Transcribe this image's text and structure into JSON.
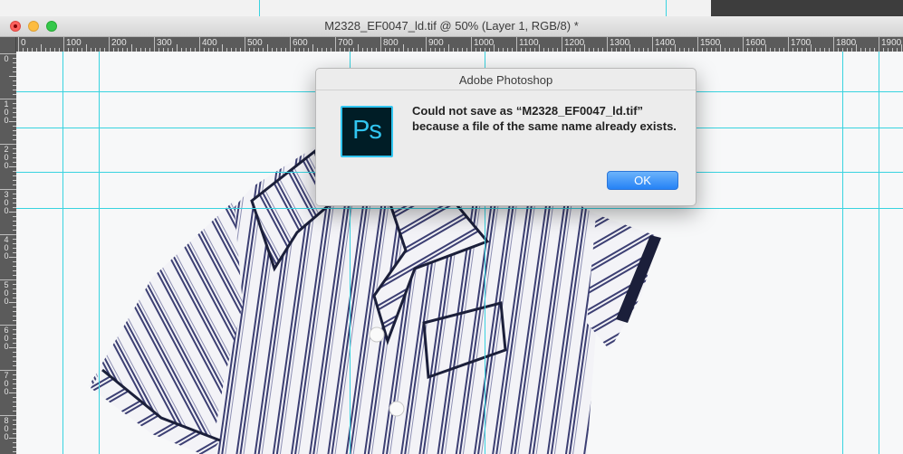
{
  "window": {
    "title": "M2328_EF0047_ld.tif @ 50% (Layer 1, RGB/8) *"
  },
  "ruler": {
    "horizontal_labels": [
      "0",
      "100",
      "200",
      "300",
      "400",
      "500",
      "600",
      "700",
      "800",
      "900",
      "1000",
      "1100",
      "1200",
      "1300",
      "1400",
      "1500",
      "1600",
      "1700",
      "1800",
      "1900"
    ],
    "vertical_labels": [
      "0",
      "100",
      "200",
      "300",
      "400",
      "500",
      "600",
      "700",
      "800"
    ]
  },
  "dialog": {
    "title": "Adobe Photoshop",
    "icon_text": "Ps",
    "icon": "photoshop-app-icon",
    "message": "Could not save as “M2328_EF0047_ld.tif” because a file of the same name already exists.",
    "ok_label": "OK"
  },
  "colors": {
    "guide": "#39d3e0",
    "ps_icon_bg": "#001d26",
    "ps_icon_accent": "#31c5f0",
    "ok_button": "#2582f6"
  }
}
